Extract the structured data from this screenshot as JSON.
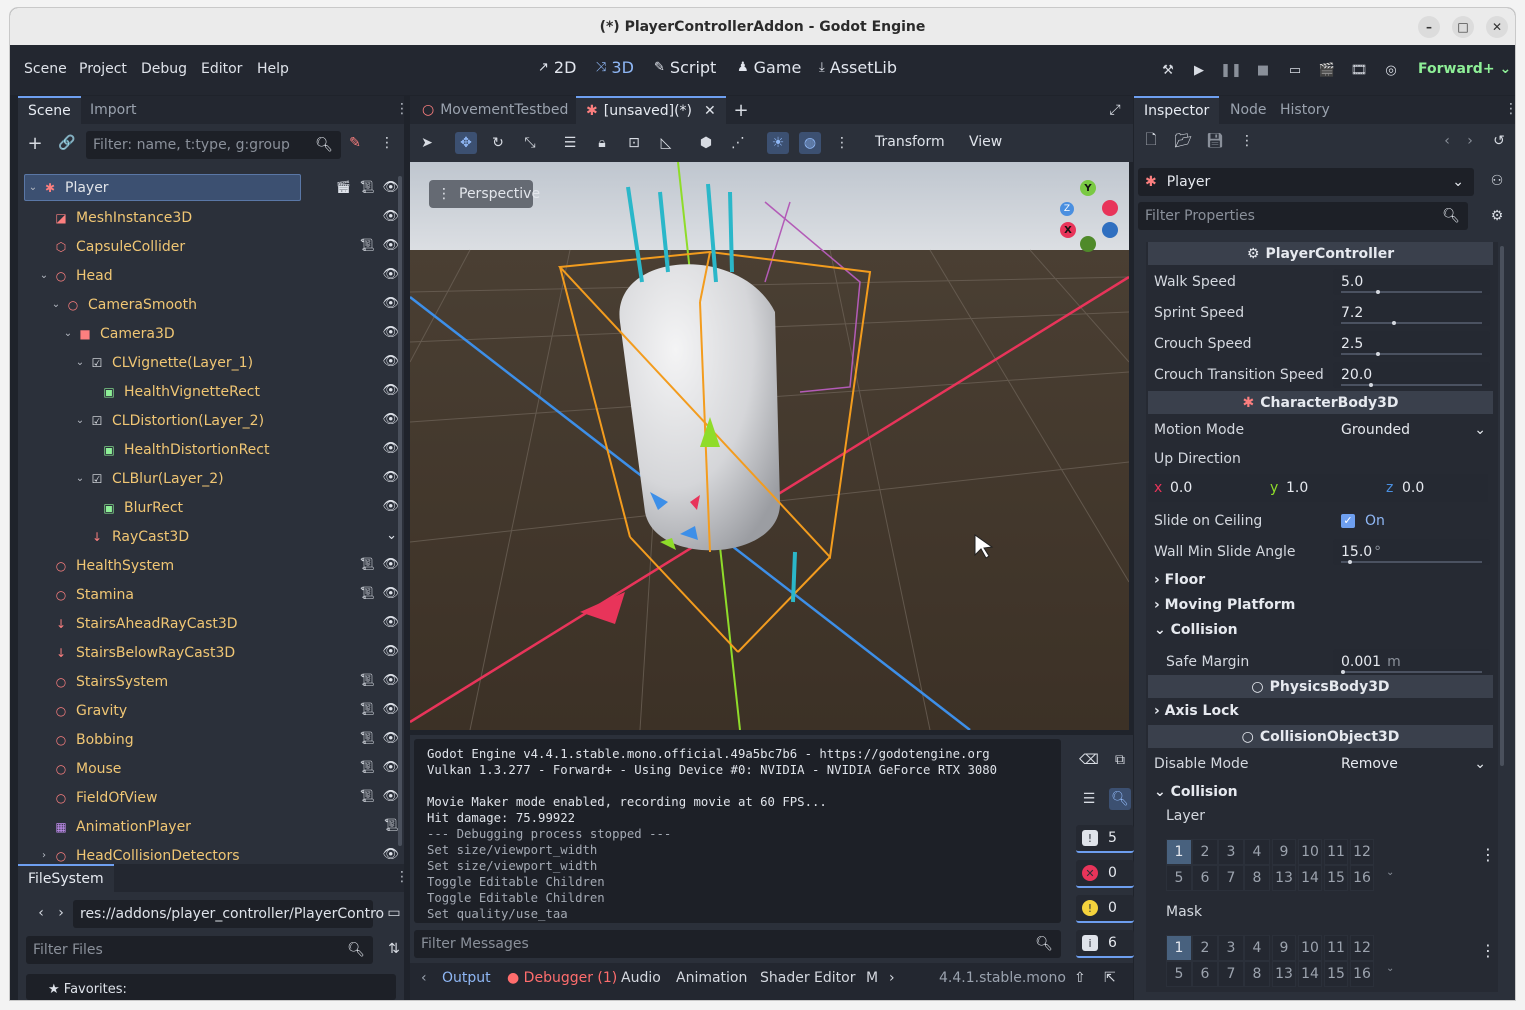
{
  "window": {
    "title": "(*) PlayerControllerAddon - Godot Engine",
    "minimize": "–",
    "maximize": "□",
    "close": "✕"
  },
  "menu": [
    "Scene",
    "Project",
    "Debug",
    "Editor",
    "Help"
  ],
  "modes": [
    {
      "label": "2D",
      "icon": "↗"
    },
    {
      "label": "3D",
      "icon": "⤨"
    },
    {
      "label": "Script",
      "icon": "✎"
    },
    {
      "label": "Game",
      "icon": "♟"
    },
    {
      "label": "AssetLib",
      "icon": "⤓"
    }
  ],
  "renderer": "Forward+",
  "scene_dock": {
    "tabs": [
      "Scene",
      "Import"
    ],
    "filter_placeholder": "Filter: name, t:type, g:group",
    "nodes": [
      {
        "name": "Player",
        "icon": "✱",
        "color": "#e0e3e8",
        "icon_color": "#fc7f7f",
        "indent": 0,
        "arrow": "⌄",
        "selected": true,
        "script": true,
        "clapper": true
      },
      {
        "name": "MeshInstance3D",
        "icon": "◪",
        "icon_color": "#fc7f7f",
        "indent": 1
      },
      {
        "name": "CapsuleCollider",
        "icon": "⬡",
        "icon_color": "#fc7f7f",
        "indent": 1,
        "script": true
      },
      {
        "name": "Head",
        "icon": "○",
        "icon_color": "#fc7f7f",
        "indent": 1,
        "arrow": "⌄"
      },
      {
        "name": "CameraSmooth",
        "icon": "○",
        "icon_color": "#fc7f7f",
        "indent": 2,
        "arrow": "⌄"
      },
      {
        "name": "Camera3D",
        "icon": "■",
        "icon_color": "#fc7f7f",
        "indent": 3,
        "arrow": "⌄"
      },
      {
        "name": "CLVignette(Layer_1)",
        "icon": "☑",
        "icon_color": "#e0e3e8",
        "indent": 4,
        "arrow": "⌄"
      },
      {
        "name": "HealthVignetteRect",
        "icon": "▣",
        "icon_color": "#8eef97",
        "indent": 5
      },
      {
        "name": "CLDistortion(Layer_2)",
        "icon": "☑",
        "icon_color": "#e0e3e8",
        "indent": 4,
        "arrow": "⌄"
      },
      {
        "name": "HealthDistortionRect",
        "icon": "▣",
        "icon_color": "#8eef97",
        "indent": 5
      },
      {
        "name": "CLBlur(Layer_2)",
        "icon": "☑",
        "icon_color": "#e0e3e8",
        "indent": 4,
        "arrow": "⌄"
      },
      {
        "name": "BlurRect",
        "icon": "▣",
        "icon_color": "#8eef97",
        "indent": 5
      },
      {
        "name": "RayCast3D",
        "icon": "↓",
        "icon_color": "#fc7f7f",
        "indent": 4,
        "chev": true
      },
      {
        "name": "HealthSystem",
        "icon": "○",
        "icon_color": "#fc7f7f",
        "indent": 1,
        "script": true
      },
      {
        "name": "Stamina",
        "icon": "○",
        "icon_color": "#fc7f7f",
        "indent": 1,
        "script": true
      },
      {
        "name": "StairsAheadRayCast3D",
        "icon": "↓",
        "icon_color": "#fc7f7f",
        "indent": 1
      },
      {
        "name": "StairsBelowRayCast3D",
        "icon": "↓",
        "icon_color": "#fc7f7f",
        "indent": 1
      },
      {
        "name": "StairsSystem",
        "icon": "○",
        "icon_color": "#fc7f7f",
        "indent": 1,
        "script": true
      },
      {
        "name": "Gravity",
        "icon": "○",
        "icon_color": "#fc7f7f",
        "indent": 1,
        "script": true
      },
      {
        "name": "Bobbing",
        "icon": "○",
        "icon_color": "#fc7f7f",
        "indent": 1,
        "script": true
      },
      {
        "name": "Mouse",
        "icon": "○",
        "icon_color": "#fc7f7f",
        "indent": 1,
        "script": true
      },
      {
        "name": "FieldOfView",
        "icon": "○",
        "icon_color": "#fc7f7f",
        "indent": 1,
        "script": true
      },
      {
        "name": "AnimationPlayer",
        "icon": "▦",
        "icon_color": "#c38ef1",
        "indent": 1,
        "script_only": true
      },
      {
        "name": "HeadCollisionDetectors",
        "icon": "○",
        "icon_color": "#fc7f7f",
        "indent": 1,
        "arrow": "›"
      }
    ]
  },
  "filesystem": {
    "tab": "FileSystem",
    "path": "res://addons/player_controller/PlayerContro",
    "filter_placeholder": "Filter Files",
    "favorites": "Favorites:"
  },
  "editor_tabs": [
    {
      "label": "MovementTestbed",
      "icon": "○",
      "active": false
    },
    {
      "label": "[unsaved](*)",
      "icon": "✱",
      "active": true
    }
  ],
  "viewport": {
    "menus": [
      "Transform",
      "View"
    ],
    "perspective": "Perspective",
    "gizmo": {
      "y": "Y",
      "z": "Z",
      "x": "X"
    }
  },
  "console": {
    "lines": [
      {
        "t": "Godot Engine v4.4.1.stable.mono.official.49a5bc7b6 - https://godotengine.org",
        "dim": false
      },
      {
        "t": "Vulkan 1.3.277 - Forward+ - Using Device #0: NVIDIA - NVIDIA GeForce RTX 3080",
        "dim": false
      },
      {
        "t": "",
        "dim": false
      },
      {
        "t": "Movie Maker mode enabled, recording movie at 60 FPS...",
        "dim": false
      },
      {
        "t": "Hit damage: 75.99922",
        "dim": false
      },
      {
        "t": "--- Debugging process stopped ---",
        "dim": true
      },
      {
        "t": "Set size/viewport_width",
        "dim": true
      },
      {
        "t": "Set size/viewport_width",
        "dim": true
      },
      {
        "t": "Toggle Editable Children",
        "dim": true
      },
      {
        "t": "Toggle Editable Children",
        "dim": true
      },
      {
        "t": "Set quality/use_taa",
        "dim": true
      }
    ],
    "filter_placeholder": "Filter Messages",
    "counts": {
      "messages": "5",
      "errors": "0",
      "warnings": "0",
      "info": "6"
    }
  },
  "bottom_tabs": [
    "Output",
    "Debugger (1)",
    "Audio",
    "Animation",
    "Shader Editor",
    "M"
  ],
  "version": "4.4.1.stable.mono",
  "inspector": {
    "tabs": [
      "Inspector",
      "Node",
      "History"
    ],
    "object": "Player",
    "filter_placeholder": "Filter Properties",
    "sections": {
      "player_controller": "PlayerController",
      "character_body": "CharacterBody3D",
      "physics_body": "PhysicsBody3D",
      "collision_object": "CollisionObject3D"
    },
    "props": {
      "walk_speed": {
        "label": "Walk Speed",
        "value": "5.0",
        "fraction": 0.25
      },
      "sprint_speed": {
        "label": "Sprint Speed",
        "value": "7.2",
        "fraction": 0.36
      },
      "crouch_speed": {
        "label": "Crouch Speed",
        "value": "2.5",
        "fraction": 0.25
      },
      "crouch_transition": {
        "label": "Crouch Transition Speed",
        "value": "20.0",
        "fraction": 0.2
      },
      "motion_mode": {
        "label": "Motion Mode",
        "value": "Grounded"
      },
      "up_direction": {
        "label": "Up Direction",
        "x": "0.0",
        "y": "1.0",
        "z": "0.0"
      },
      "slide_on_ceiling": {
        "label": "Slide on Ceiling",
        "value": "On"
      },
      "wall_min_slide": {
        "label": "Wall Min Slide Angle",
        "value": "15.0",
        "unit": "°",
        "fraction": 0.05
      },
      "safe_margin": {
        "label": "Safe Margin",
        "value": "0.001",
        "unit": "m"
      },
      "disable_mode": {
        "label": "Disable Mode",
        "value": "Remove"
      }
    },
    "groups": {
      "floor": "Floor",
      "moving_platform": "Moving Platform",
      "collision": "Collision",
      "axis_lock": "Axis Lock",
      "collision2": "Collision",
      "layer": "Layer",
      "mask": "Mask"
    },
    "layers_row1": [
      "1",
      "2",
      "3",
      "4",
      "9",
      "10",
      "11",
      "12"
    ],
    "layers_row2": [
      "5",
      "6",
      "7",
      "8",
      "13",
      "14",
      "15",
      "16"
    ]
  }
}
